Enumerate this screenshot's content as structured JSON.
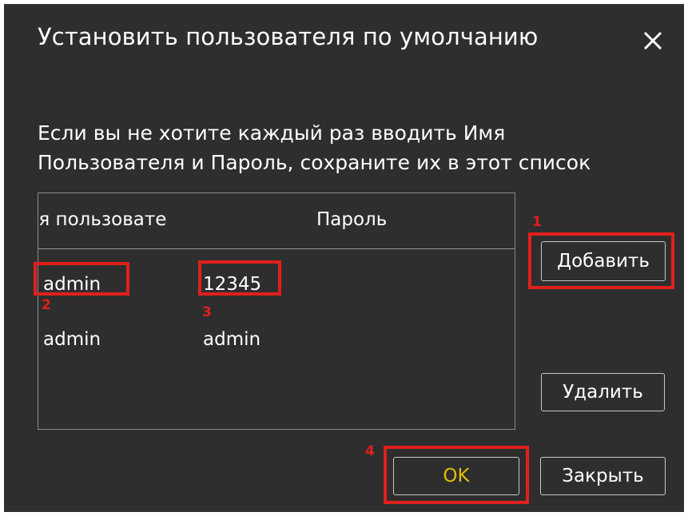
{
  "dialog": {
    "title": "Установить пользователя по умолчанию",
    "close_icon": "close-icon",
    "description_line1": "Если вы не хотите каждый раз вводить Имя",
    "description_line2": "Пользователя и Пароль, сохраните их в этот список"
  },
  "table": {
    "columns": [
      "ıя пользовате",
      "Пароль"
    ],
    "rows": [
      {
        "username": "admin",
        "password": "12345"
      },
      {
        "username": "admin",
        "password": "admin"
      }
    ]
  },
  "buttons": {
    "add": "Добавить",
    "delete": "Удалить",
    "ok": "OK",
    "close": "Закрыть"
  },
  "annotations": {
    "markers": [
      "1",
      "2",
      "3",
      "4"
    ],
    "color": "#e0201c"
  },
  "colors": {
    "dialog_bg": "#2e2e2e",
    "text": "#ffffff",
    "ok_text": "#e0c000"
  }
}
